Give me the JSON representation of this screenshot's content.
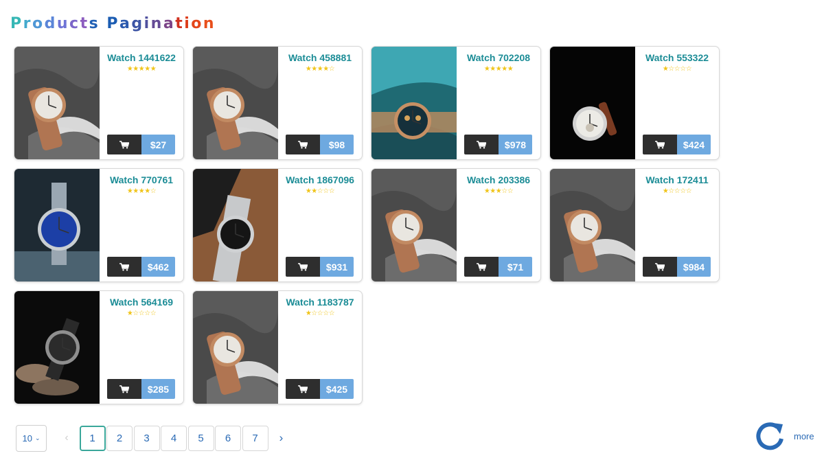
{
  "title": "Products Pagination",
  "title_colors": [
    "#36b7b5",
    "#43a9cd",
    "#4f97d6",
    "#5b85d8",
    "#6f74d6",
    "#7c66c9",
    "#8c5dbf",
    "#2060b5",
    "#1b5cb2",
    "#2a59ad",
    "#3d55a5",
    "#4f509e",
    "#644a95",
    "#7c4488",
    "#d0311f",
    "#dc3b18",
    "#e4461a",
    "#e84f1c",
    "#ec591e"
  ],
  "accent_colors": {
    "title_teal": "#1b8c96",
    "cart_dark": "#2e2e2e",
    "price_blue": "#6ea9e0",
    "link_blue": "#2a6ab5",
    "star_gold": "#f0c419",
    "active_page_border": "#3aa79a"
  },
  "cart_icon": "shopping-cart-icon",
  "products": [
    {
      "name": "Watch 1441622",
      "rating": 5,
      "price": "$27",
      "image": "rose-gold-watch-grey-cloth"
    },
    {
      "name": "Watch 458881",
      "rating": 4,
      "price": "$98",
      "image": "rose-gold-watch-grey-cloth"
    },
    {
      "name": "Watch 702208",
      "rating": 5,
      "price": "$978",
      "image": "chronograph-watch-teal-ice"
    },
    {
      "name": "Watch 553322",
      "rating": 1,
      "price": "$424",
      "image": "white-dial-watch-black"
    },
    {
      "name": "Watch 770761",
      "rating": 4,
      "price": "$462",
      "image": "blue-dial-mesh-watch"
    },
    {
      "name": "Watch 1867096",
      "rating": 2,
      "price": "$931",
      "image": "steel-chronograph-wood"
    },
    {
      "name": "Watch 203386",
      "rating": 3,
      "price": "$71",
      "image": "rose-gold-watch-grey-cloth"
    },
    {
      "name": "Watch 172411",
      "rating": 1,
      "price": "$984",
      "image": "rose-gold-watch-grey-cloth"
    },
    {
      "name": "Watch 564169",
      "rating": 1,
      "price": "$285",
      "image": "dark-chronograph-hand"
    },
    {
      "name": "Watch 1183787",
      "rating": 1,
      "price": "$425",
      "image": "rose-gold-watch-grey-cloth"
    }
  ],
  "rating_max": 5,
  "pagination": {
    "per_page": "10",
    "prev_icon": "chevron-left-icon",
    "next_icon": "chevron-right-icon",
    "pages": [
      "1",
      "2",
      "3",
      "4",
      "5",
      "6",
      "7"
    ],
    "current_page": "1"
  },
  "more": {
    "label": "more",
    "icon": "refresh-icon"
  }
}
